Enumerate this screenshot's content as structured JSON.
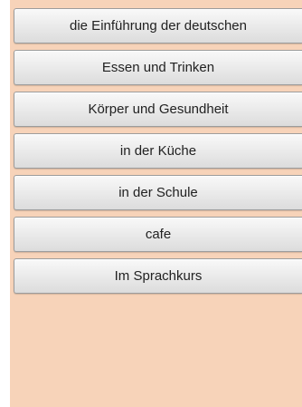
{
  "menu": {
    "items": [
      {
        "label": "die Einführung der deutschen"
      },
      {
        "label": "Essen und Trinken"
      },
      {
        "label": "Körper und Gesundheit"
      },
      {
        "label": "in der Küche"
      },
      {
        "label": "in der Schule"
      },
      {
        "label": "cafe"
      },
      {
        "label": "Im Sprachkurs"
      }
    ]
  },
  "colors": {
    "background": "#f7d3b9",
    "button_top": "#f9f9f9",
    "button_bottom": "#dcdcdc",
    "button_text": "#222222"
  }
}
